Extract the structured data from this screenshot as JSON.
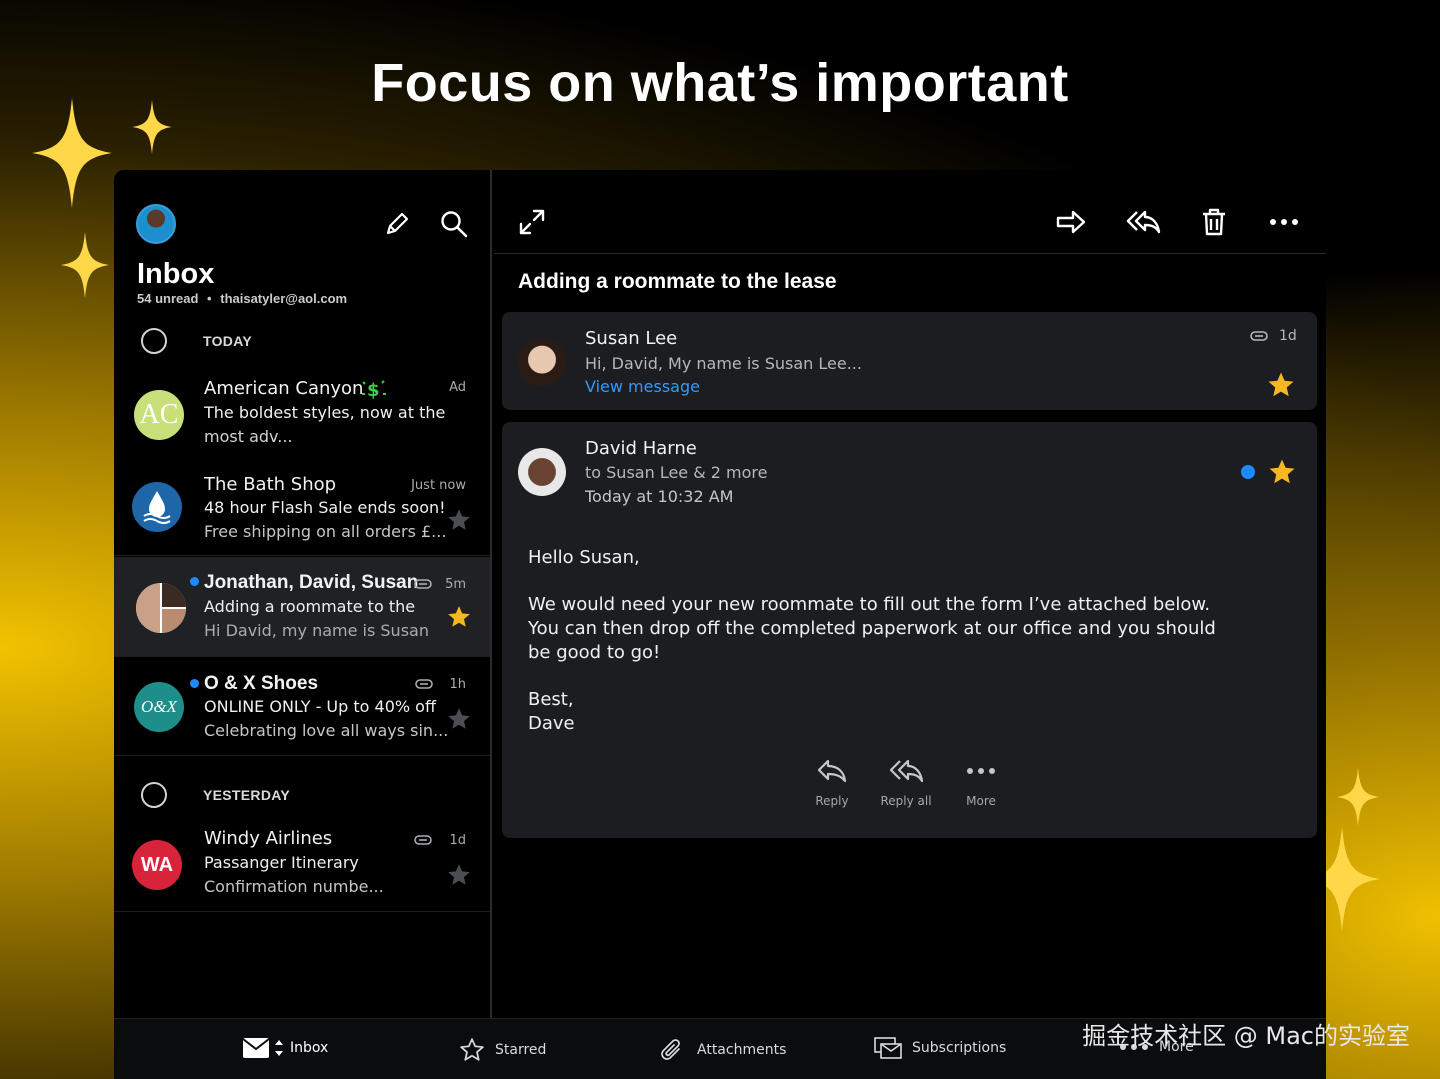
{
  "headline": "Focus on what’s important",
  "colors": {
    "accent_blue": "#1d8bff",
    "star_gold": "#f5b820",
    "link_blue": "#2e9bff"
  },
  "sidebar": {
    "title": "Inbox",
    "unread": "54 unread",
    "separator": "•",
    "email": "thaisatyler@aol.com",
    "compose_icon": "pencil-icon",
    "search_icon": "search-icon",
    "sections": {
      "today": "TODAY",
      "yesterday": "YESTERDAY"
    },
    "messages": [
      {
        "sender": "American Canyon",
        "subject": "The boldest styles, now at the",
        "preview": "most adv...",
        "time": "Ad",
        "avatar_text": "AC",
        "starred": false
      },
      {
        "sender": "The Bath Shop",
        "subject": "48 hour Flash Sale ends soon!",
        "preview": "Free shipping on all orders £...",
        "time": "Just now",
        "starred": false
      },
      {
        "sender": "Jonathan, David, Susan",
        "subject": "Adding a roommate to the",
        "preview": "Hi David, my name is Susan",
        "time": "5m",
        "unread": true,
        "attachment": true,
        "starred": true
      },
      {
        "sender": "O & X Shoes",
        "subject": "ONLINE ONLY - Up to 40% off",
        "preview": "Celebrating love all ways sin...",
        "time": "1h",
        "unread": true,
        "attachment": true,
        "avatar_text": "O&X",
        "starred": false
      },
      {
        "sender": "Windy Airlines",
        "subject": "Passanger Itinerary",
        "preview": "Confirmation numbe...",
        "time": "1d",
        "attachment": true,
        "avatar_text": "WA",
        "starred": false
      }
    ]
  },
  "reader": {
    "toolbar": {
      "expand_icon": "expand-icon",
      "forward_icon": "forward-icon",
      "reply_all_icon": "reply-all-icon",
      "delete_icon": "trash-icon",
      "more_icon": "more-icon"
    },
    "subject": "Adding a roommate to the lease",
    "thread": [
      {
        "name": "Susan Lee",
        "snippet": "Hi, David, My name is Susan Lee...",
        "link": "View message",
        "time": "1d",
        "starred": true,
        "attachment": true
      },
      {
        "name": "David Harne",
        "recipients": "to Susan Lee & 2 more",
        "date": "Today at 10:32 AM",
        "unread": true,
        "starred": true,
        "body": {
          "greeting": "Hello Susan,",
          "paragraph": "We would need your new roommate to fill out the form I’ve attached below. You can then drop off the completed paperwork at our office and you should be good to go!",
          "closing": "Best,",
          "signature": "Dave"
        }
      }
    ],
    "actions": {
      "reply": "Reply",
      "reply_all": "Reply all",
      "more": "More"
    }
  },
  "bottom_tabs": {
    "inbox": "Inbox",
    "starred": "Starred",
    "attachments": "Attachments",
    "subscriptions": "Subscriptions",
    "more": "More"
  },
  "watermark": "掘金技术社区 @ Mac的实验室"
}
